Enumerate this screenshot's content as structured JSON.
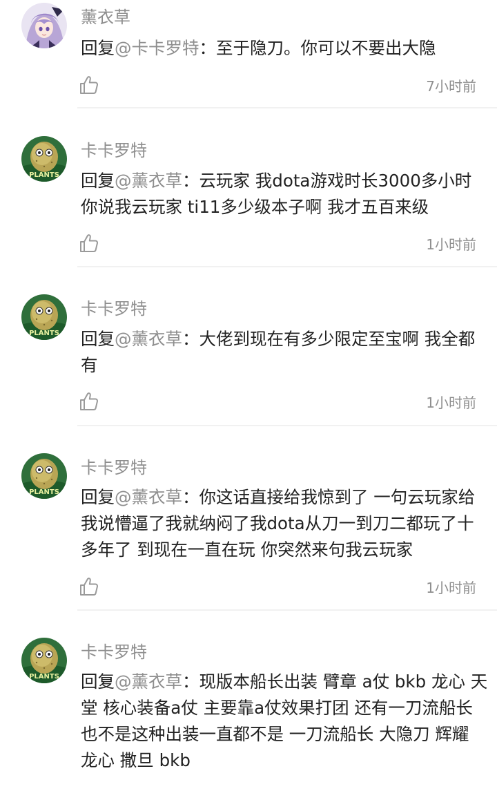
{
  "comments": [
    {
      "username": "薰衣草",
      "reply_prefix": "回复",
      "mention": "@卡卡罗特",
      "separator": "：",
      "text": "至于隐刀。你可以不要出大隐",
      "time": "7小时前"
    },
    {
      "username": "卡卡罗特",
      "reply_prefix": "回复",
      "mention": "@薰衣草",
      "separator": "：",
      "text": "云玩家 我dota游戏时长3000多小时你说我云玩家 ti11多少级本子啊 我才五百来级",
      "time": "1小时前"
    },
    {
      "username": "卡卡罗特",
      "reply_prefix": "回复",
      "mention": "@薰衣草",
      "separator": "：",
      "text": "大佬到现在有多少限定至宝啊 我全都有",
      "time": "1小时前"
    },
    {
      "username": "卡卡罗特",
      "reply_prefix": "回复",
      "mention": "@薰衣草",
      "separator": "：",
      "text": "你这话直接给我惊到了 一句云玩家给我说懵逼了我就纳闷了我dota从刀一到刀二都玩了十多年了 到现在一直在玩 你突然来句我云玩家",
      "time": "1小时前"
    },
    {
      "username": "卡卡罗特",
      "reply_prefix": "回复",
      "mention": "@薰衣草",
      "separator": "：",
      "text": "现版本船长出装 臂章 a仗 bkb 龙心 天堂  核心装备a仗 主要靠a仗效果打团 还有一刀流船长也不是这种出装一直都不是 一刀流船长 大隐刀 辉耀  龙心 撒旦 bkb"
    }
  ],
  "icons": {
    "like": "thumbs-up-icon",
    "avatar_lavender": "anime-girl-avatar",
    "avatar_kakarot": "potato-mascot-avatar"
  },
  "colors": {
    "text": "#222222",
    "muted": "#8e8e8e",
    "divider": "#f1f1f1"
  }
}
